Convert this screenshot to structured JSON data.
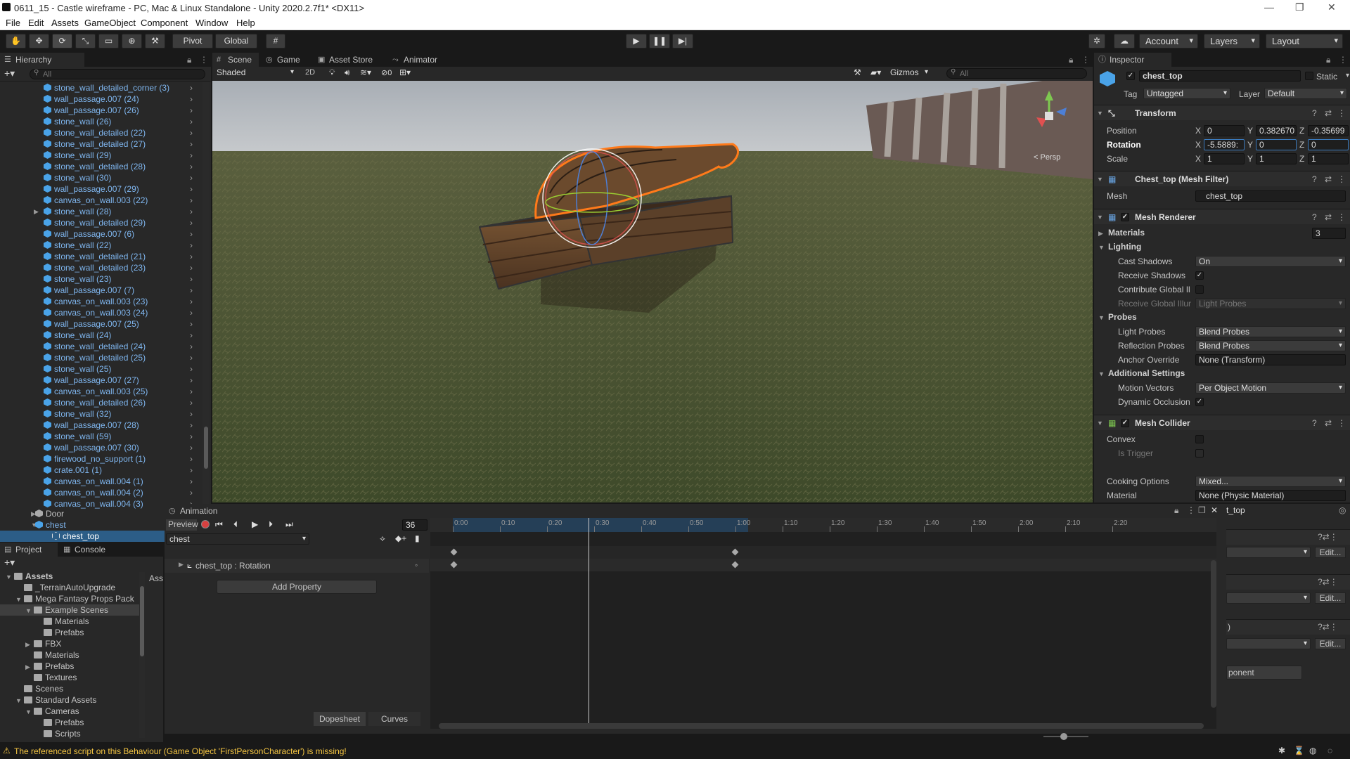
{
  "window": {
    "title": "0611_15 - Castle wireframe - PC, Mac & Linux Standalone - Unity 2020.2.7f1* <DX11>",
    "minimize": "—",
    "maximize": "❐",
    "close": "✕"
  },
  "menu": [
    "File",
    "Edit",
    "Assets",
    "GameObject",
    "Component",
    "Window",
    "Help"
  ],
  "toolbar": {
    "pivot": "Pivot",
    "global": "Global",
    "account": "Account",
    "layers": "Layers",
    "layout": "Layout"
  },
  "hierarchy": {
    "tab": "Hierarchy",
    "search_placeholder": "All",
    "items": [
      "stone_wall_detailed_corner (3)",
      "wall_passage.007 (24)",
      "wall_passage.007 (26)",
      "stone_wall (26)",
      "stone_wall_detailed (22)",
      "stone_wall_detailed (27)",
      "stone_wall (29)",
      "stone_wall_detailed (28)",
      "stone_wall (30)",
      "wall_passage.007 (29)",
      "canvas_on_wall.003 (22)",
      "stone_wall (28)",
      "stone_wall_detailed (29)",
      "wall_passage.007 (6)",
      "stone_wall (22)",
      "stone_wall_detailed (21)",
      "stone_wall_detailed (23)",
      "stone_wall (23)",
      "wall_passage.007 (7)",
      "canvas_on_wall.003 (23)",
      "canvas_on_wall.003 (24)",
      "wall_passage.007 (25)",
      "stone_wall (24)",
      "stone_wall_detailed (24)",
      "stone_wall_detailed (25)",
      "stone_wall (25)",
      "wall_passage.007 (27)",
      "canvas_on_wall.003 (25)",
      "stone_wall_detailed (26)",
      "stone_wall (32)",
      "wall_passage.007 (28)",
      "stone_wall (59)",
      "wall_passage.007 (30)",
      "firewood_no_support (1)",
      "crate.001 (1)",
      "canvas_on_wall.004 (1)",
      "canvas_on_wall.004 (2)",
      "canvas_on_wall.004 (3)"
    ],
    "door": "Door",
    "chest": "chest",
    "chest_top": "chest_top"
  },
  "scene": {
    "tabs": [
      "Scene",
      "Game",
      "Asset Store",
      "Animator"
    ],
    "shading": "Shaded",
    "mode2d": "2D",
    "hidden_count": "0",
    "gizmos": "Gizmos",
    "search_placeholder": "All",
    "persp": "< Persp"
  },
  "animation": {
    "tab": "Animation",
    "preview": "Preview",
    "frame": "36",
    "clip": "chest",
    "property": "chest_top : Rotation",
    "add_property": "Add Property",
    "dopesheet": "Dopesheet",
    "curves": "Curves",
    "ticks": [
      "0:00",
      "0:10",
      "0:20",
      "0:30",
      "0:40",
      "0:50",
      "1:00",
      "1:10",
      "1:20",
      "1:30",
      "1:40",
      "1:50",
      "2:00",
      "2:10",
      "2:20"
    ]
  },
  "project": {
    "tabs": [
      "Project",
      "Console"
    ],
    "assets_label": "Assets",
    "breadcrumb": "Ass",
    "tree": [
      {
        "label": "Assets",
        "level": 0,
        "exp": "▼",
        "bold": true
      },
      {
        "label": "_TerrainAutoUpgrade",
        "level": 1,
        "exp": ""
      },
      {
        "label": "Mega Fantasy Props Pack",
        "level": 1,
        "exp": "▼"
      },
      {
        "label": "Example Scenes",
        "level": 2,
        "exp": "▼",
        "selected": true
      },
      {
        "label": "Materials",
        "level": 3,
        "exp": ""
      },
      {
        "label": "Prefabs",
        "level": 3,
        "exp": ""
      },
      {
        "label": "FBX",
        "level": 2,
        "exp": "▶"
      },
      {
        "label": "Materials",
        "level": 2,
        "exp": ""
      },
      {
        "label": "Prefabs",
        "level": 2,
        "exp": "▶"
      },
      {
        "label": "Textures",
        "level": 2,
        "exp": ""
      },
      {
        "label": "Scenes",
        "level": 1,
        "exp": ""
      },
      {
        "label": "Standard Assets",
        "level": 1,
        "exp": "▼"
      },
      {
        "label": "Cameras",
        "level": 2,
        "exp": "▼"
      },
      {
        "label": "Prefabs",
        "level": 3,
        "exp": ""
      },
      {
        "label": "Scripts",
        "level": 3,
        "exp": ""
      }
    ]
  },
  "inspector": {
    "tab": "Inspector",
    "object_name": "chest_top",
    "static": "Static",
    "tag_label": "Tag",
    "tag": "Untagged",
    "layer_label": "Layer",
    "layer": "Default",
    "transform": {
      "title": "Transform",
      "position_label": "Position",
      "rotation_label": "Rotation",
      "scale_label": "Scale",
      "position": [
        "0",
        "0.382670",
        "-0.35699"
      ],
      "rotation": [
        "-5.5889:",
        "0",
        "0"
      ],
      "scale": [
        "1",
        "1",
        "1"
      ]
    },
    "mesh_filter": {
      "title": "Chest_top (Mesh Filter)",
      "mesh_label": "Mesh",
      "mesh": "chest_top"
    },
    "mesh_renderer": {
      "title": "Mesh Renderer",
      "materials_label": "Materials",
      "materials_count": "3",
      "lighting": "Lighting",
      "cast_shadows_label": "Cast Shadows",
      "cast_shadows": "On",
      "receive_shadows_label": "Receive Shadows",
      "contribute_gi_label": "Contribute Global Il",
      "receive_gi_label": "Receive Global Illur",
      "receive_gi": "Light Probes",
      "probes": "Probes",
      "light_probes_label": "Light Probes",
      "light_probes": "Blend Probes",
      "reflection_probes_label": "Reflection Probes",
      "reflection_probes": "Blend Probes",
      "anchor_label": "Anchor Override",
      "anchor": "None (Transform)",
      "additional": "Additional Settings",
      "motion_vectors_label": "Motion Vectors",
      "motion_vectors": "Per Object Motion",
      "dynamic_occlusion_label": "Dynamic Occlusion"
    },
    "mesh_collider": {
      "title": "Mesh Collider",
      "convex_label": "Convex",
      "is_trigger_label": "Is Trigger",
      "cooking_label": "Cooking Options",
      "cooking": "Mixed...",
      "material_label": "Material",
      "material": "None (Physic Material)"
    },
    "popup_title": "t_top",
    "edit": "Edit...",
    "component_btn": "ponent",
    "paren": ")"
  },
  "status": {
    "warning": "The referenced script on this Behaviour (Game Object 'FirstPersonCharacter') is missing!"
  },
  "colors": {
    "accent": "#2c5d87",
    "prefab": "#7fb6ef",
    "selection_outline": "#ff7a1a",
    "warning": "#f4c542"
  }
}
